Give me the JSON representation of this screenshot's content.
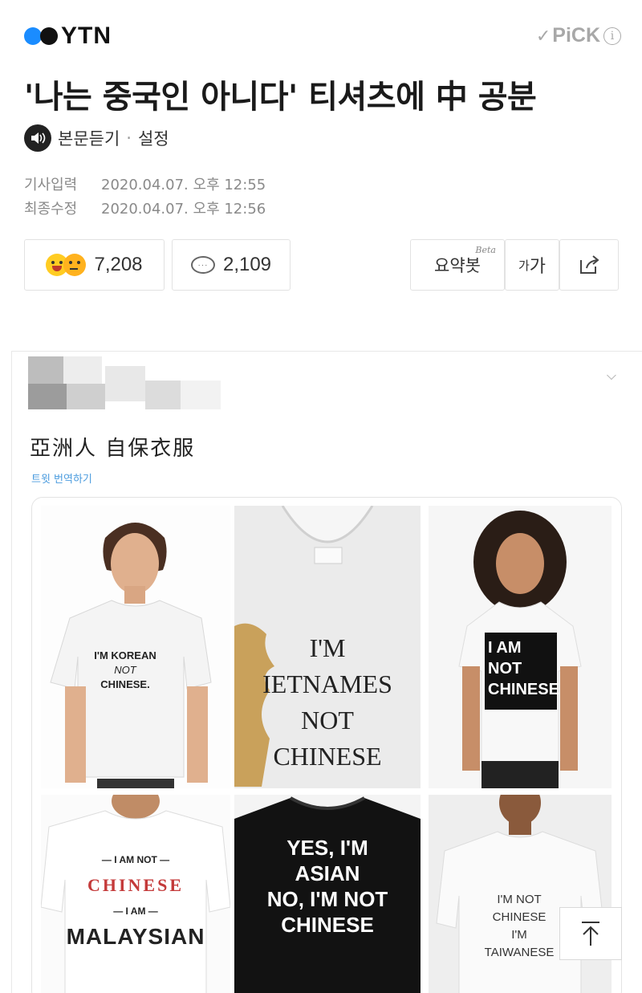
{
  "header": {
    "brand": "YTN",
    "pick_label": "PiCK",
    "pick_info": "i"
  },
  "article": {
    "title": "'나는 중국인 아니다' 티셔츠에 中 공분",
    "listen_label": "본문듣기",
    "separator": "·",
    "settings_label": "설정",
    "published_label": "기사입력",
    "published_value": "2020.04.07. 오후 12:55",
    "modified_label": "최종수정",
    "modified_value": "2020.04.07. 오후 12:56"
  },
  "actions": {
    "reactions_count": "7,208",
    "comments_count": "2,109",
    "comment_dots": "···",
    "summary_label": "요약봇",
    "summary_badge": "Beta",
    "font_small": "가",
    "font_large": "가"
  },
  "tweet": {
    "text": "亞洲人 自保衣服",
    "translate_label": "트윗 번역하기",
    "shirts": {
      "s1": {
        "l1": "I'M KOREAN",
        "l2": "NOT",
        "l3": "CHINESE."
      },
      "s2": {
        "l1": "I'M",
        "l2": "IETNAMES",
        "l3": "NOT",
        "l4": "CHINESE"
      },
      "s3": {
        "l1": "I AM",
        "l2": "NOT",
        "l3": "CHINESE"
      },
      "s4": {
        "l1": "— I AM NOT —",
        "l2": "CHINESE",
        "l3": "— I AM —",
        "l4": "MALAYSIAN"
      },
      "s5": {
        "l1": "YES, I'M",
        "l2": "ASIAN",
        "l3": "NO, I'M NOT",
        "l4": "CHINESE"
      },
      "s6": {
        "l1": "I'M NOT",
        "l2": "CHINESE",
        "l3": "I'M",
        "l4": "TAIWANESE"
      }
    }
  },
  "icons": [
    "speaker-icon",
    "emoji-laugh-icon",
    "emoji-sad-icon",
    "comment-bubble-icon",
    "share-icon",
    "chevron-down-icon",
    "scroll-top-icon"
  ],
  "colors": {
    "accent_blue": "#1a8cff",
    "link_blue": "#4a9bde",
    "pick_gray": "#a8a8a8"
  }
}
